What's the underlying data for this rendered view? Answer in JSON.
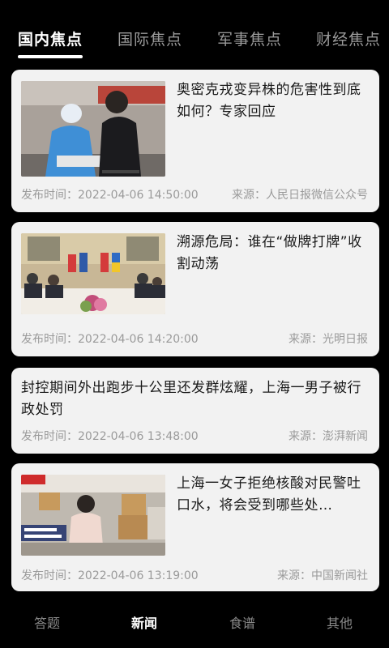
{
  "tabs": [
    {
      "label": "国内焦点",
      "active": true
    },
    {
      "label": "国际焦点",
      "active": false
    },
    {
      "label": "军事焦点",
      "active": false
    },
    {
      "label": "财经焦点",
      "active": false
    }
  ],
  "news": [
    {
      "title": "奥密克戎变异株的危害性到底如何？专家回应",
      "time": "发布时间：2022-04-06 14:50:00",
      "source": "来源：人民日报微信公众号",
      "image": "health-worker-testing-photo"
    },
    {
      "title": "溯源危局：谁在“做牌打牌”收割动荡",
      "time": "发布时间：2022-04-06 14:20:00",
      "source": "来源：光明日报",
      "image": "diplomatic-meeting-photo"
    },
    {
      "title": "封控期间外出跑步十公里还发群炫耀，上海一男子被行政处罚",
      "time": "发布时间：2022-04-06 13:48:00",
      "source": "来源：澎湃新闻"
    },
    {
      "title": "上海一女子拒绝核酸对民警吐口水，将会受到哪些处…",
      "time": "发布时间：2022-04-06 13:19:00",
      "source": "来源：中国新闻社",
      "image": "video-news-still-photo"
    }
  ],
  "bottom_nav": [
    {
      "label": "答题",
      "active": false
    },
    {
      "label": "新闻",
      "active": true
    },
    {
      "label": "食谱",
      "active": false
    },
    {
      "label": "其他",
      "active": false
    }
  ],
  "colors": {
    "background": "#000000",
    "card": "#f2f2f2",
    "text_primary": "#1a1a1a",
    "text_secondary": "#9a9a9a",
    "tab_active": "#ffffff",
    "tab_inactive": "#9a9a9a"
  }
}
